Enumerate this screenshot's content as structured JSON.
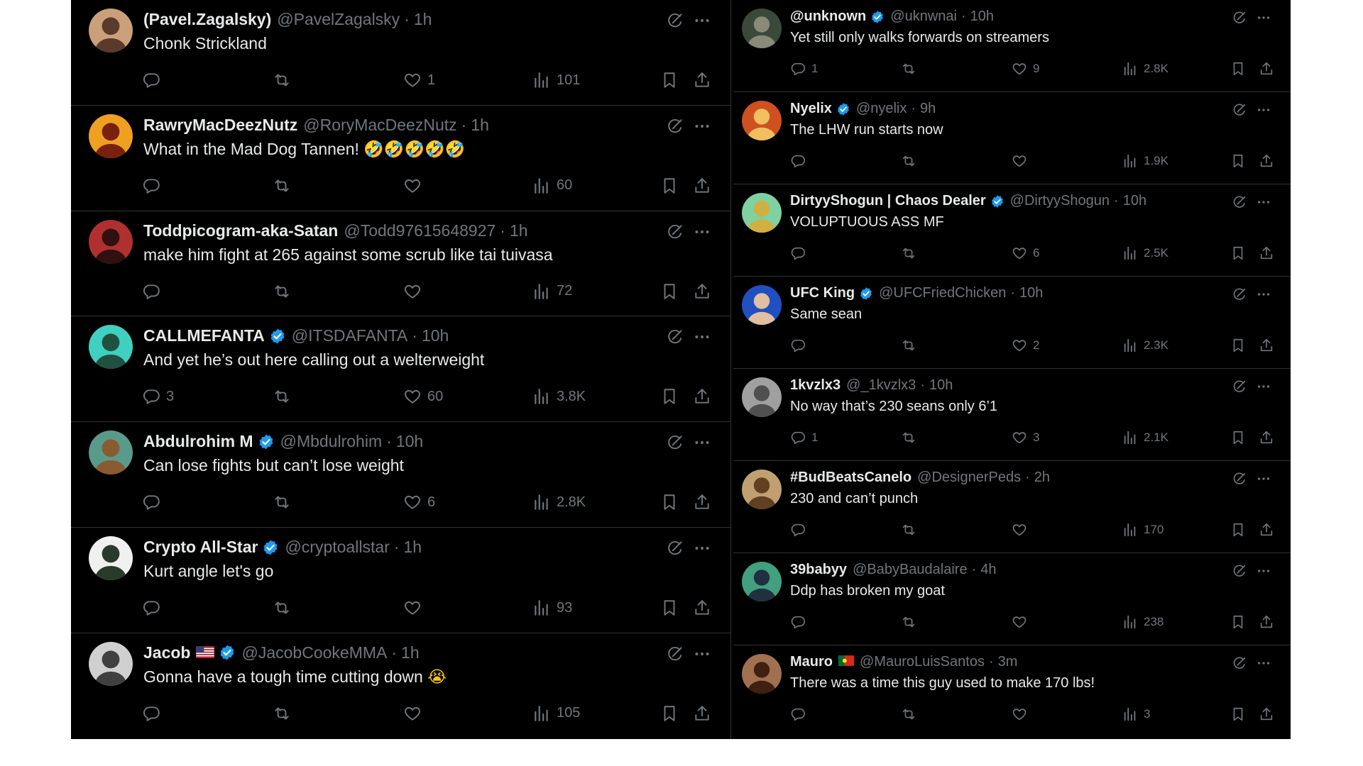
{
  "colors": {
    "background": "#000000",
    "text": "#e7e9ea",
    "muted": "#71767b",
    "divider": "#2f3336",
    "verified": "#1d9bf0"
  },
  "icons": {
    "reply": "reply-icon",
    "repost": "repost-icon",
    "like": "like-icon",
    "views": "views-icon",
    "bookmark": "bookmark-icon",
    "share": "share-icon",
    "grok": "grok-icon",
    "more": "more-icon",
    "verified": "verified-badge-icon"
  },
  "left_tweets": [
    {
      "name": "(Pavel.Zagalsky)",
      "handle": "@PavelZagalsky",
      "sep": "·",
      "time": "1h",
      "text": "Chonk Strickland",
      "replies": "",
      "reposts": "",
      "likes": "1",
      "views": "101",
      "verified": false
    },
    {
      "name": "RawryMacDeezNutz",
      "handle": "@RoryMacDeezNutz",
      "sep": "·",
      "time": "1h",
      "text": "What in the Mad Dog Tannen! ",
      "emoji": "🤣🤣🤣🤣🤣",
      "replies": "",
      "reposts": "",
      "likes": "",
      "views": "60",
      "verified": false
    },
    {
      "name": "Toddpicogram-aka-Satan",
      "handle": "@Todd97615648927",
      "sep": "·",
      "time": "1h",
      "text": "make him fight at 265 against some scrub like tai tuivasa",
      "replies": "",
      "reposts": "",
      "likes": "",
      "views": "72",
      "verified": false
    },
    {
      "name": "CALLMEFANTA",
      "handle": "@ITSDAFANTA",
      "sep": "·",
      "time": "10h",
      "text": "And yet he’s out here calling out a welterweight",
      "replies": "3",
      "reposts": "",
      "likes": "60",
      "views": "3.8K",
      "verified": true
    },
    {
      "name": "Abdulrohim M",
      "handle": "@Mbdulrohim",
      "sep": "·",
      "time": "10h",
      "text": "Can lose fights but can’t lose weight",
      "replies": "",
      "reposts": "",
      "likes": "6",
      "views": "2.8K",
      "verified": true
    },
    {
      "name": "Crypto All-Star",
      "handle": "@cryptoallstar",
      "sep": "·",
      "time": "1h",
      "text": "Kurt angle let's go",
      "replies": "",
      "reposts": "",
      "likes": "",
      "views": "93",
      "verified": true
    },
    {
      "name": "Jacob",
      "handle": "@JacobCookeMMA",
      "sep": "·",
      "time": "1h",
      "text": "Gonna have a tough time cutting down ",
      "emoji": "😭",
      "flag": "us-flag",
      "replies": "",
      "reposts": "",
      "likes": "",
      "views": "105",
      "verified": true
    }
  ],
  "right_tweets": [
    {
      "name": "@unknown",
      "handle": "@uknwnai",
      "sep": "·",
      "time": "10h",
      "text": "Yet still only walks forwards on streamers",
      "replies": "1",
      "reposts": "",
      "likes": "9",
      "views": "2.8K",
      "verified": true
    },
    {
      "name": "Nyelix",
      "handle": "@nyelix",
      "sep": "·",
      "time": "9h",
      "text": "The LHW run starts now",
      "replies": "",
      "reposts": "",
      "likes": "",
      "views": "1.9K",
      "verified": true
    },
    {
      "name": "DirtyyShogun | Chaos Dealer",
      "handle": "@DirtyyShogun",
      "sep": "·",
      "time": "10h",
      "text": "VOLUPTUOUS ASS MF",
      "replies": "",
      "reposts": "",
      "likes": "6",
      "views": "2.5K",
      "verified": true
    },
    {
      "name": "UFC King",
      "handle": "@UFCFriedChicken",
      "sep": "·",
      "time": "10h",
      "text": "Same sean",
      "replies": "",
      "reposts": "",
      "likes": "2",
      "views": "2.3K",
      "verified": true
    },
    {
      "name": "1kvzlx3",
      "handle": "@_1kvzlx3",
      "sep": "·",
      "time": "10h",
      "text": "No way that’s 230 seans only 6’1",
      "replies": "1",
      "reposts": "",
      "likes": "3",
      "views": "2.1K",
      "verified": false
    },
    {
      "name": "#BudBeatsCanelo",
      "handle": "@DesignerPeds",
      "sep": "·",
      "time": "2h",
      "text": "230 and can’t punch",
      "replies": "",
      "reposts": "",
      "likes": "",
      "views": "170",
      "verified": false
    },
    {
      "name": "39babyy",
      "handle": "@BabyBaudalaire",
      "sep": "·",
      "time": "4h",
      "text": "Ddp has broken my goat",
      "replies": "",
      "reposts": "",
      "likes": "",
      "views": "238",
      "verified": false
    },
    {
      "name": "Mauro",
      "handle": "@MauroLuisSantos",
      "sep": "·",
      "time": "3m",
      "text": "There was a time this guy used to make 170 lbs!",
      "flag": "portugal-flag",
      "replies": "",
      "reposts": "",
      "likes": "",
      "views": "3",
      "verified": false
    }
  ]
}
